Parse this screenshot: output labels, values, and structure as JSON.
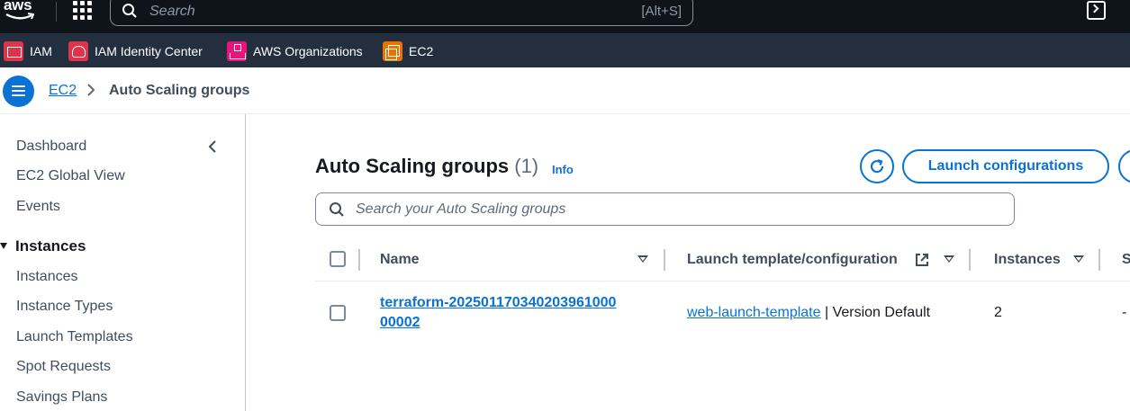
{
  "topnav": {
    "logo_text": "aws",
    "search_placeholder": "Search",
    "search_shortcut": "[Alt+S]"
  },
  "favorites": [
    {
      "label": "IAM",
      "icon": "iam-icon",
      "color": "#dd344c"
    },
    {
      "label": "IAM Identity Center",
      "icon": "iam-identity-center-icon",
      "color": "#dd344c"
    },
    {
      "label": "AWS Organizations",
      "icon": "aws-organizations-icon",
      "color": "#e7157b"
    },
    {
      "label": "EC2",
      "icon": "ec2-icon",
      "color": "#ed7100"
    }
  ],
  "breadcrumb": {
    "parent": "EC2",
    "current": "Auto Scaling groups"
  },
  "sidebar": {
    "items_top": [
      "Dashboard",
      "EC2 Global View",
      "Events"
    ],
    "section": "Instances",
    "section_items": [
      "Instances",
      "Instance Types",
      "Launch Templates",
      "Spot Requests",
      "Savings Plans"
    ]
  },
  "main": {
    "title": "Auto Scaling groups",
    "count": "(1)",
    "info": "Info",
    "launch_configurations_label": "Launch configurations",
    "search_placeholder": "Search your Auto Scaling groups"
  },
  "table": {
    "columns": [
      "Name",
      "Launch template/configuration",
      "Instances",
      "S"
    ],
    "rows": [
      {
        "name": "terraform-2025011703402039610000 0002",
        "name_line1": "terraform-20250117034020396100​0",
        "name_line2": "00002",
        "launch_template_link": "web-launch-template",
        "launch_template_suffix": " | Version Default",
        "instances": "2",
        "status": "-"
      }
    ]
  },
  "colors": {
    "accent": "#0972d3",
    "topnav_bg": "#0f141a",
    "favbar_bg": "#232f3e",
    "aws_orange": "#ff9900"
  }
}
